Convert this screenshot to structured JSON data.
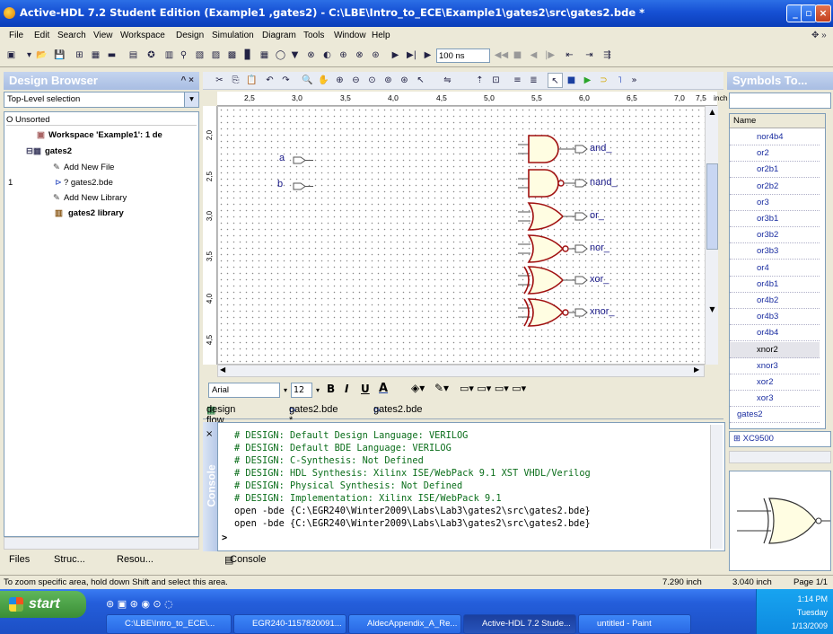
{
  "window": {
    "title": "Active-HDL 7.2 Student Edition (Example1 ,gates2) - C:\\LBE\\Intro_to_ECE\\Example1\\gates2\\src\\gates2.bde *",
    "btn_min": "_",
    "btn_max": "▫",
    "btn_close": "×"
  },
  "menu": [
    "File",
    "Edit",
    "Search",
    "View",
    "Workspace",
    "Design",
    "Simulation",
    "Diagram",
    "Tools",
    "Window",
    "Help"
  ],
  "toolbar": {
    "time_value": "100 ns"
  },
  "design_browser": {
    "title": "Design Browser",
    "selection": "Top-Level selection",
    "unsorted": "O Unsorted",
    "workspace": "Workspace 'Example1': 1 de",
    "design": "gates2",
    "add_new_file": "Add New File",
    "row_num": "1",
    "gates2_file": "? gates2.bde",
    "add_new_library": "Add New Library",
    "gates2_library": "gates2 library",
    "tabs": [
      "Files",
      "Struc...",
      "Resou..."
    ]
  },
  "ruler": {
    "top": [
      "2,5",
      "3,0",
      "3,5",
      "4,0",
      "4,5",
      "5,0",
      "5,5",
      "6,0",
      "6,5",
      "7,0",
      "7,5",
      "inch"
    ],
    "left": [
      "2,0",
      "2,5",
      "3,0",
      "3,5",
      "4,0",
      "4,5"
    ]
  },
  "schematic": {
    "inputs": [
      "a",
      "b"
    ],
    "outputs": [
      "and_",
      "nand_",
      "or_",
      "nor_",
      "xor_",
      "xnor_"
    ],
    "pin_in": "a",
    "pin_in2": "b",
    "pin_out": "b"
  },
  "format_bar": {
    "font": "Arial",
    "size": "12",
    "bold": "B",
    "italic": "I",
    "underline": "U",
    "font_color": "A"
  },
  "doc_tabs": [
    "design flow",
    "gates2.bde *",
    "gates2.bde"
  ],
  "console": {
    "title": "Console",
    "side_label": "Console",
    "lines": [
      "# DESIGN: Default Design Language: VERILOG",
      "# DESIGN: Default BDE Language: VERILOG",
      "# DESIGN: C-Synthesis: Not Defined",
      "# DESIGN: HDL Synthesis: Xilinx ISE/WebPack 9.1 XST VHDL/Verilog",
      "# DESIGN: Physical Synthesis: Not Defined",
      "# DESIGN: Implementation: Xilinx ISE/WebPack 9.1",
      "open -bde {C:\\EGR240\\Winter2009\\Labs\\Lab3\\gates2\\src\\gates2.bde}",
      "open -bde {C:\\EGR240\\Winter2009\\Labs\\Lab3\\gates2\\src\\gates2.bde}"
    ],
    "prompt": ">"
  },
  "symbols": {
    "title": "Symbols To...",
    "col_header": "Name",
    "items": [
      "nor4b4",
      "or2",
      "or2b1",
      "or2b2",
      "or3",
      "or3b1",
      "or3b2",
      "or3b3",
      "or4",
      "or4b1",
      "or4b2",
      "or4b3",
      "or4b4",
      "xnor2",
      "xnor3",
      "xor2",
      "xor3",
      "gates2"
    ],
    "selected": "xnor2",
    "group": "XC9500"
  },
  "status": {
    "hint": "To zoom specific area, hold down Shift and select this area.",
    "x": "7.290 inch",
    "y": "3.040 inch",
    "page": "Page 1/1"
  },
  "taskbar": {
    "start": "start",
    "tasks": [
      "C:\\LBE\\Intro_to_ECE\\...",
      "EGR240-1157820091...",
      "AldecAppendix_A_Re...",
      "Active-HDL 7.2 Stude...",
      "untitled - Paint"
    ],
    "time": "1:14 PM",
    "day": "Tuesday",
    "date": "1/13/2009"
  }
}
